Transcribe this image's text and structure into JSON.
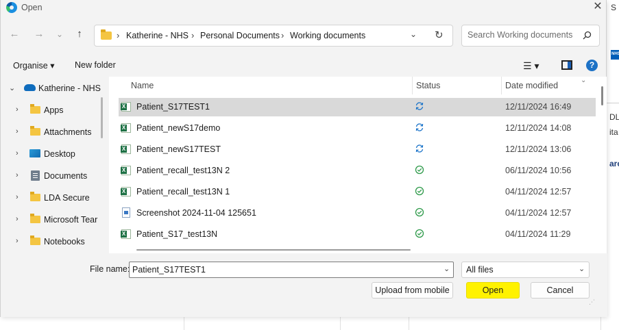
{
  "background_app": {
    "title_fragment": "S E",
    "logo_text": "NHS",
    "text1": "DL -",
    "text2": "ita",
    "text3": "arc"
  },
  "dialog": {
    "title": "Open",
    "close_glyph": "✕"
  },
  "nav": {
    "back_glyph": "←",
    "forward_glyph": "→",
    "recent_glyph": "⌄",
    "up_glyph": "↑",
    "breadcrumb": [
      "Katherine - NHS",
      "Personal Documents",
      "Working documents"
    ],
    "separator": "›",
    "dropdown_glyph": "⌄",
    "refresh_glyph": "↻"
  },
  "search": {
    "placeholder": "Search Working documents"
  },
  "command_bar": {
    "organise": "Organise ▾",
    "new_folder": "New folder",
    "view_glyph": "☰ ▾",
    "help": "?"
  },
  "nav_pane": {
    "items": [
      {
        "label": "Katherine - NHS",
        "icon": "cloud-icon",
        "chevron": "⌄"
      },
      {
        "label": "Apps",
        "icon": "folder-icon",
        "chevron": "›"
      },
      {
        "label": "Attachments",
        "icon": "folder-icon",
        "chevron": "›"
      },
      {
        "label": "Desktop",
        "icon": "desktop-icon",
        "chevron": "›"
      },
      {
        "label": "Documents",
        "icon": "documents-icon",
        "chevron": "›"
      },
      {
        "label": "LDA Secure",
        "icon": "folder-icon",
        "chevron": "›"
      },
      {
        "label": "Microsoft Tear",
        "icon": "folder-icon",
        "chevron": "›"
      },
      {
        "label": "Notebooks",
        "icon": "folder-icon",
        "chevron": "›"
      }
    ]
  },
  "file_list": {
    "columns": [
      "Name",
      "Status",
      "Date modified"
    ],
    "sort_glyph": "⌄",
    "rows": [
      {
        "name": "Patient_S17TEST1",
        "type": "excel",
        "status": "syncing",
        "date": "12/11/2024 16:49",
        "selected": true
      },
      {
        "name": "Patient_newS17demo",
        "type": "excel",
        "status": "syncing",
        "date": "12/11/2024 14:08",
        "selected": false
      },
      {
        "name": "Patient_newS17TEST",
        "type": "excel",
        "status": "syncing",
        "date": "12/11/2024 13:06",
        "selected": false
      },
      {
        "name": "Patient_recall_test13N 2",
        "type": "excel",
        "status": "synced",
        "date": "06/11/2024 10:56",
        "selected": false
      },
      {
        "name": "Patient_recall_test13N 1",
        "type": "excel",
        "status": "synced",
        "date": "04/11/2024 12:57",
        "selected": false
      },
      {
        "name": "Screenshot 2024-11-04 125651",
        "type": "image",
        "status": "synced",
        "date": "04/11/2024 12:57",
        "selected": false
      },
      {
        "name": "Patient_S17_test13N",
        "type": "excel",
        "status": "synced",
        "date": "04/11/2024 11:29",
        "selected": false
      }
    ]
  },
  "bottom": {
    "file_name_label": "File name:",
    "file_name_value": "Patient_S17TEST1",
    "file_type": "All files",
    "dropdown_glyph": "⌄",
    "upload_button": "Upload from mobile",
    "open_button": "Open",
    "cancel_button": "Cancel"
  },
  "colors": {
    "open_highlight": "#fff200",
    "selected_row": "#d9d9d9",
    "sync_blue": "#1a73c9",
    "synced_green": "#2e9a4a",
    "excel_green": "#1e7145"
  }
}
